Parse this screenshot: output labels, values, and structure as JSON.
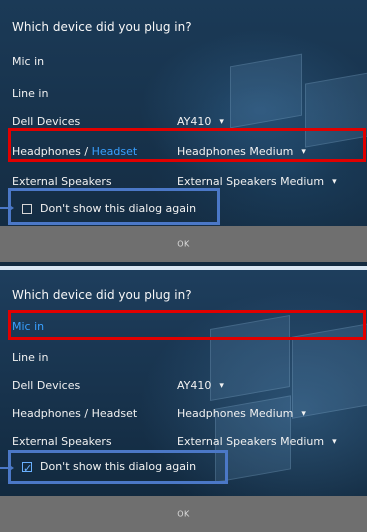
{
  "dialog1": {
    "title": "Which device did you plug in?",
    "mic": "Mic in",
    "line": "Line in",
    "dell_label": "Dell Devices",
    "dell_value": "AY410",
    "headphones_label_prefix": "Headphones / ",
    "headphones_label_highlight": "Headset",
    "headphones_value": "Headphones Medium",
    "speakers_label": "External Speakers",
    "speakers_value": "External Speakers Medium",
    "checkbox_label": "Don't show this dialog again",
    "ok": "OK",
    "checkbox_checked": false
  },
  "dialog2": {
    "title": "Which device did you plug in?",
    "mic": "Mic in",
    "line": "Line in",
    "dell_label": "Dell Devices",
    "dell_value": "AY410",
    "headphones_label": "Headphones / Headset",
    "headphones_value": "Headphones Medium",
    "speakers_label": "External Speakers",
    "speakers_value": "External Speakers Medium",
    "checkbox_label": "Don't show this dialog again",
    "ok": "OK",
    "checkbox_checked": true
  },
  "colors": {
    "accent_blue": "#39a0ff",
    "callout_red": "#e10000",
    "callout_blue": "#4b78c7"
  },
  "icons": {
    "dropdown": "chevron-down-icon",
    "check": "check-icon"
  }
}
